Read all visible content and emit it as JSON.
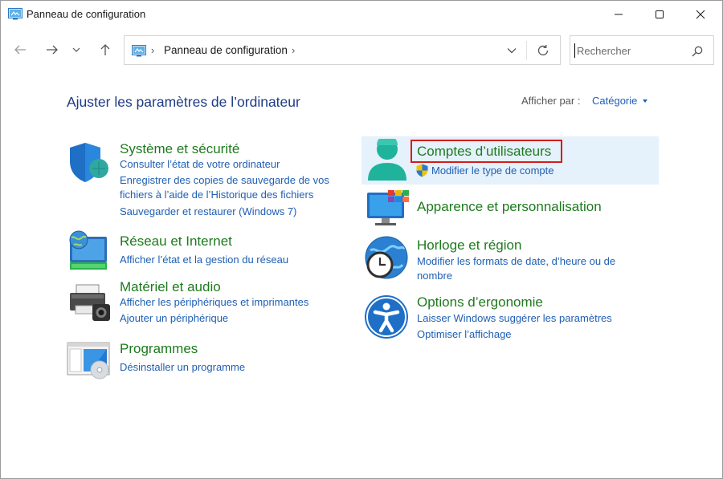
{
  "window": {
    "title": "Panneau de configuration"
  },
  "navigation": {
    "address": "Panneau de configuration",
    "search_placeholder": "Rechercher"
  },
  "header": {
    "heading": "Ajuster les paramètres de l’ordinateur",
    "view_by_label": "Afficher par :",
    "view_by_value": "Catégorie"
  },
  "categories_left": [
    {
      "icon": "shield-icon",
      "title": "Système et sécurité",
      "links": [
        "Consulter l’état de votre ordinateur",
        "Enregistrer des copies de sauvegarde de vos",
        "fichiers à l’aide de l’Historique des fichiers",
        "Sauvegarder et restaurer (Windows 7)"
      ]
    },
    {
      "icon": "network-globe-icon",
      "title": "Réseau et Internet",
      "links": [
        "Afficher l’état et la gestion du réseau"
      ]
    },
    {
      "icon": "printer-icon",
      "title": "Matériel et audio",
      "links": [
        "Afficher les périphériques et imprimantes",
        "Ajouter un périphérique"
      ]
    },
    {
      "icon": "programs-icon",
      "title": "Programmes",
      "links": [
        "Désinstaller un programme"
      ]
    }
  ],
  "categories_right": [
    {
      "icon": "user-accounts-icon",
      "title": "Comptes d’utilisateurs",
      "links": [
        "Modifier le type de compte"
      ]
    },
    {
      "icon": "appearance-monitor-icon",
      "title": "Apparence et personnalisation",
      "links": []
    },
    {
      "icon": "clock-globe-icon",
      "title": "Horloge et région",
      "links": [
        "Modifier les formats de date, d’heure ou de",
        "nombre"
      ]
    },
    {
      "icon": "accessibility-icon",
      "title": "Options d’ergonomie",
      "links": [
        "Laisser Windows suggérer les paramètres",
        "Optimiser l’affichage"
      ]
    }
  ],
  "colors": {
    "category_title": "#1e7a1e",
    "link": "#1f5fb3",
    "heading": "#1f3b86",
    "highlight": "#e5f1fb",
    "annotation_box": "#d81b1b"
  }
}
